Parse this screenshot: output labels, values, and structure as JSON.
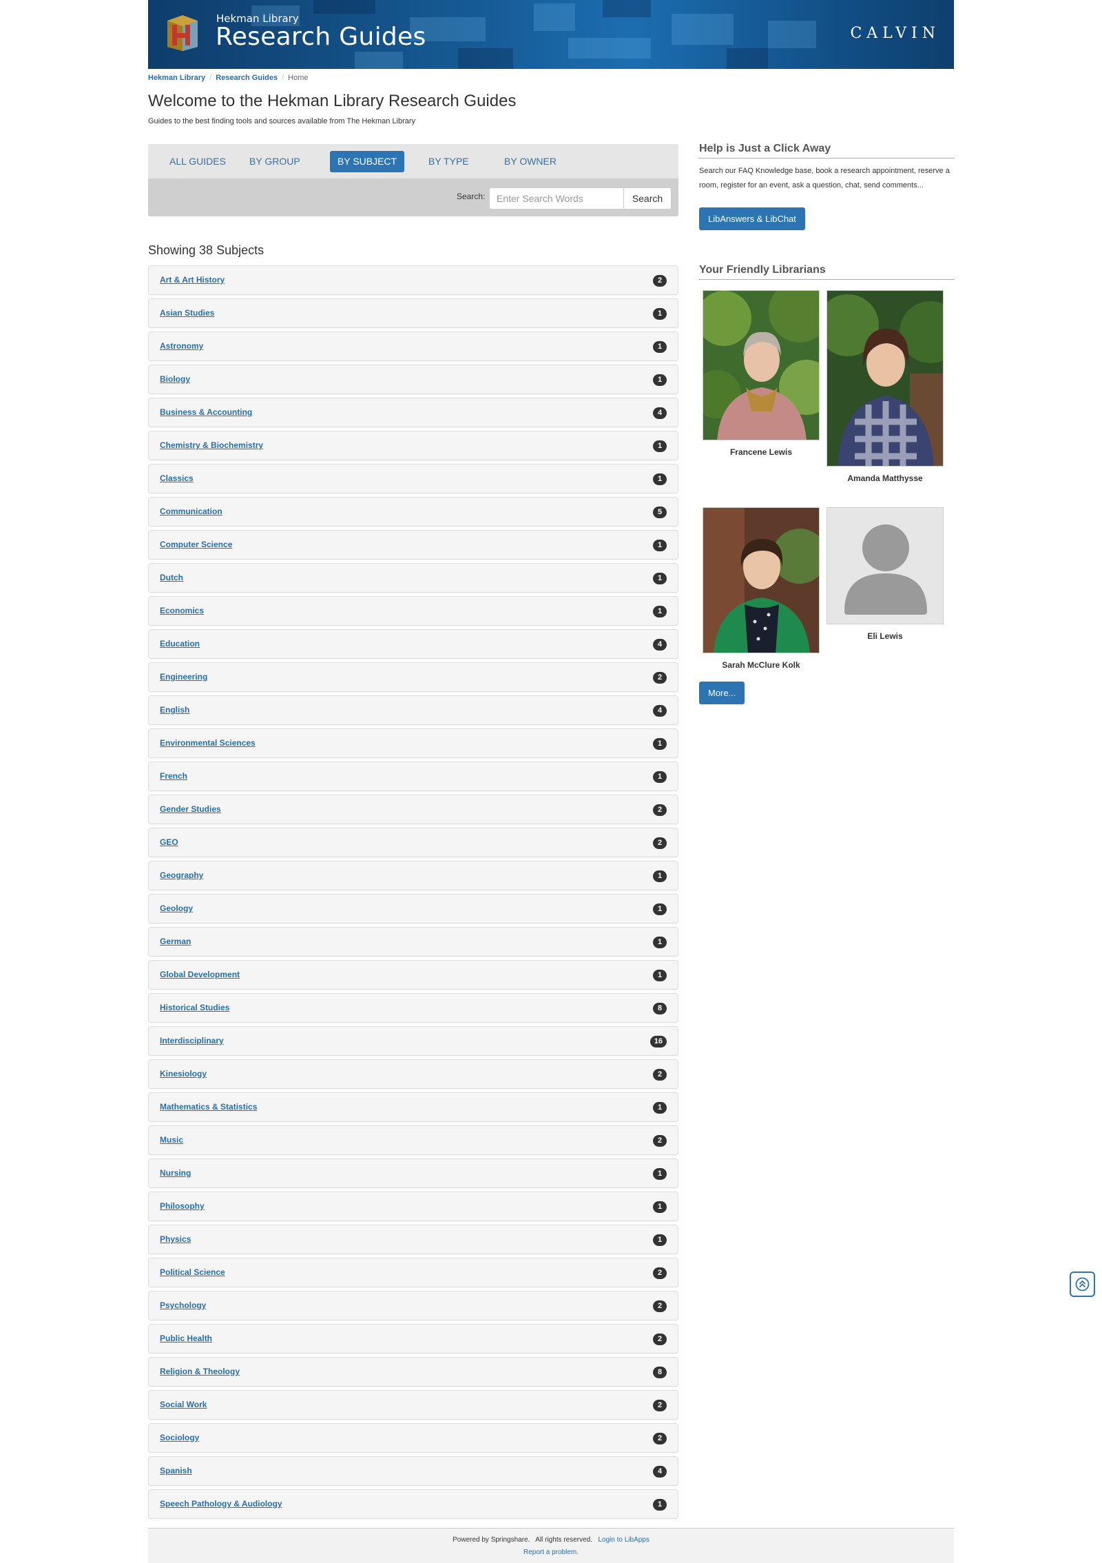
{
  "banner": {
    "subtitle": "Hekman Library",
    "title": "Research Guides",
    "institution": "CALVIN"
  },
  "breadcrumb": {
    "items": [
      "Hekman Library",
      "Research Guides"
    ],
    "current": "Home"
  },
  "page": {
    "title": "Welcome to the Hekman Library Research Guides",
    "description": "Guides to the best finding tools and sources available from The Hekman Library"
  },
  "tabs": [
    "ALL GUIDES",
    "BY GROUP",
    "BY SUBJECT",
    "BY TYPE",
    "BY OWNER"
  ],
  "active_tab": "BY SUBJECT",
  "search": {
    "label": "Search:",
    "placeholder": "Enter Search Words",
    "button": "Search"
  },
  "showing": "Showing 38 Subjects",
  "subjects": [
    {
      "name": "Art & Art History",
      "count": "2"
    },
    {
      "name": "Asian Studies",
      "count": "1"
    },
    {
      "name": "Astronomy",
      "count": "1"
    },
    {
      "name": "Biology",
      "count": "1"
    },
    {
      "name": "Business & Accounting",
      "count": "4"
    },
    {
      "name": "Chemistry & Biochemistry",
      "count": "1"
    },
    {
      "name": "Classics",
      "count": "1"
    },
    {
      "name": "Communication",
      "count": "5"
    },
    {
      "name": "Computer Science",
      "count": "1"
    },
    {
      "name": "Dutch",
      "count": "1"
    },
    {
      "name": "Economics",
      "count": "1"
    },
    {
      "name": "Education",
      "count": "4"
    },
    {
      "name": "Engineering",
      "count": "2"
    },
    {
      "name": "English",
      "count": "4"
    },
    {
      "name": "Environmental Sciences",
      "count": "1"
    },
    {
      "name": "French",
      "count": "1"
    },
    {
      "name": "Gender Studies",
      "count": "2"
    },
    {
      "name": "GEO",
      "count": "2"
    },
    {
      "name": "Geography",
      "count": "1"
    },
    {
      "name": "Geology",
      "count": "1"
    },
    {
      "name": "German",
      "count": "1"
    },
    {
      "name": "Global Development",
      "count": "1"
    },
    {
      "name": "Historical Studies",
      "count": "8"
    },
    {
      "name": "Interdisciplinary",
      "count": "16"
    },
    {
      "name": "Kinesiology",
      "count": "2"
    },
    {
      "name": "Mathematics & Statistics",
      "count": "1"
    },
    {
      "name": "Music",
      "count": "2"
    },
    {
      "name": "Nursing",
      "count": "1"
    },
    {
      "name": "Philosophy",
      "count": "1"
    },
    {
      "name": "Physics",
      "count": "1"
    },
    {
      "name": "Political Science",
      "count": "2"
    },
    {
      "name": "Psychology",
      "count": "2"
    },
    {
      "name": "Public Health",
      "count": "2"
    },
    {
      "name": "Religion & Theology",
      "count": "8"
    },
    {
      "name": "Social Work",
      "count": "2"
    },
    {
      "name": "Sociology",
      "count": "2"
    },
    {
      "name": "Spanish",
      "count": "4"
    },
    {
      "name": "Speech Pathology & Audiology",
      "count": "1"
    }
  ],
  "help": {
    "title": "Help is Just a Click Away",
    "text": "Search our FAQ Knowledge base, book a research appointment, reserve a room, register for an event, ask a question, chat, send comments...",
    "button": "LibAnswers & LibChat"
  },
  "librarians": {
    "title": "Your Friendly Librarians",
    "people": [
      {
        "name": "Francene Lewis"
      },
      {
        "name": "Amanda Matthysse"
      },
      {
        "name": "Sarah McClure Kolk"
      },
      {
        "name": "Eli Lewis"
      }
    ],
    "more_button": "More..."
  },
  "footer": {
    "powered": "Powered by Springshare.",
    "rights": "All rights reserved.",
    "login": "Login to LibApps",
    "report": "Report a problem."
  },
  "colors": {
    "accent": "#2c74b2",
    "link": "#2a6ea7",
    "badge": "#333333"
  }
}
